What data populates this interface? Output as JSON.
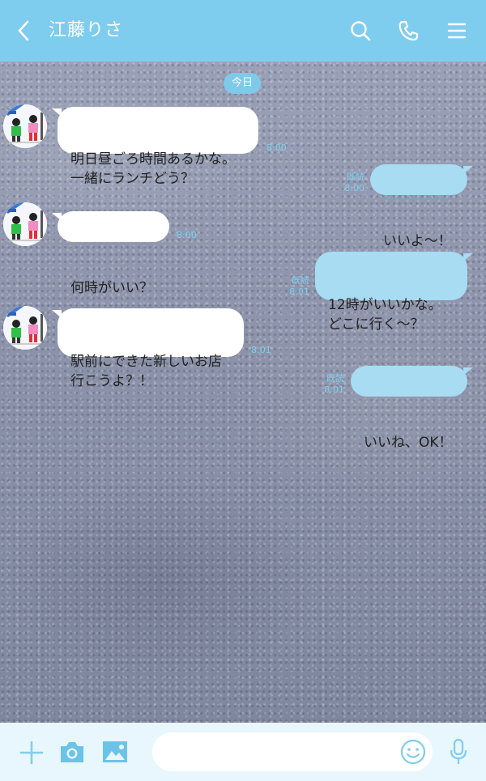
{
  "header": {
    "title": "江藤りさ",
    "icons": [
      "back-chevron-icon",
      "search-icon",
      "phone-icon",
      "menu-icon"
    ],
    "color": "#7fcdee"
  },
  "chat": {
    "date_label": "今日",
    "messages": [
      {
        "side": "incoming",
        "text": "明日昼ごろ時間あるかな。\n一緒にランチどう？",
        "time": "8:00"
      },
      {
        "side": "outgoing",
        "text": "いいよ〜！",
        "read": "既読",
        "time": "8:00"
      },
      {
        "side": "incoming",
        "text": "何時がいい？",
        "time": "8:00"
      },
      {
        "side": "outgoing",
        "text": "12時がいいかな。\nどこに行く〜？",
        "read": "既読",
        "time": "8:01"
      },
      {
        "side": "incoming",
        "text": "駅前にできた新しいお店\n行こうよ？！",
        "time": "8:01"
      },
      {
        "side": "outgoing",
        "text": "いいね、OK！",
        "read": "既読",
        "time": "8:01"
      }
    ]
  },
  "input": {
    "placeholder": "",
    "icons": [
      "plus-icon",
      "camera-icon",
      "image-icon",
      "emoji-icon",
      "microphone-icon"
    ]
  },
  "colors": {
    "accent": "#7fcdee",
    "outgoing_bubble": "#a8dcf2",
    "incoming_bubble": "#ffffff",
    "meta_text": "#7fd0f0"
  }
}
